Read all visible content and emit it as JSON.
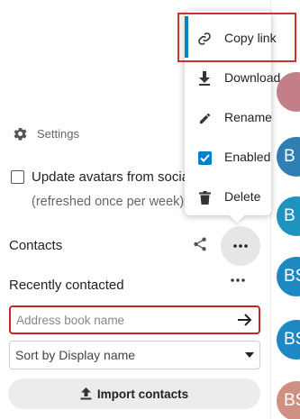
{
  "settings": {
    "label": "Settings"
  },
  "avatar_option": {
    "label": "Update avatars from social",
    "sublabel": "(refreshed once per week)",
    "checked": false
  },
  "contacts": {
    "label": "Contacts"
  },
  "recently": {
    "label": "Recently contacted"
  },
  "address_book_input": {
    "placeholder": "Address book name",
    "value": ""
  },
  "sort": {
    "selected": "Sort by Display name"
  },
  "import": {
    "label": "Import contacts"
  },
  "menu": {
    "items": [
      {
        "label": "Copy link",
        "icon": "link-icon"
      },
      {
        "label": "Download",
        "icon": "download-icon"
      },
      {
        "label": "Rename",
        "icon": "pencil-icon"
      },
      {
        "label": "Enabled",
        "icon": "checkbox-checked-icon",
        "checked": true
      },
      {
        "label": "Delete",
        "icon": "trash-icon"
      }
    ]
  },
  "avatars": [
    {
      "initials": "",
      "color": "#c47e8a"
    },
    {
      "initials": "B",
      "color": "#2f7fb5"
    },
    {
      "initials": "B",
      "color": "#1f93c0"
    },
    {
      "initials": "BS",
      "color": "#1e88c2"
    },
    {
      "initials": "BS",
      "color": "#1e88c2"
    },
    {
      "initials": "BS",
      "color": "#1e88c2"
    },
    {
      "initials": "BS",
      "color": "#cf8f82"
    }
  ],
  "colors": {
    "accent": "#0082c9",
    "error_border": "#c62828",
    "highlight": "#d32f2f"
  }
}
